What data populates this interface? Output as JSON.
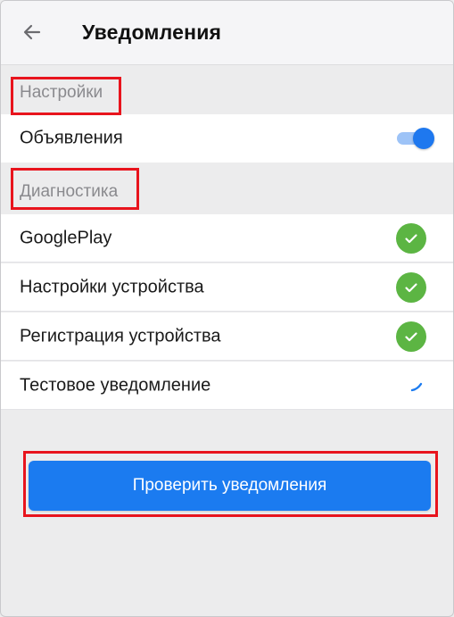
{
  "header": {
    "title": "Уведомления",
    "back_icon": "arrow-left-icon"
  },
  "settings": {
    "section_label": "Настройки",
    "items": [
      {
        "label": "Объявления",
        "control": "toggle",
        "enabled": true
      }
    ]
  },
  "diagnostics": {
    "section_label": "Диагностика",
    "items": [
      {
        "label": "GooglePlay",
        "status": "ok",
        "icon": "check-circle-icon"
      },
      {
        "label": "Настройки устройства",
        "status": "ok",
        "icon": "check-circle-icon"
      },
      {
        "label": "Регистрация устройства",
        "status": "ok",
        "icon": "check-circle-icon"
      },
      {
        "label": "Тестовое уведомление",
        "status": "loading",
        "icon": "spinner-icon"
      }
    ]
  },
  "actions": {
    "check_button_label": "Проверить уведомления"
  },
  "colors": {
    "accent": "#1b7bf0",
    "success": "#5cb543",
    "highlight": "#e8141d",
    "section_text": "#8a8a8e"
  }
}
